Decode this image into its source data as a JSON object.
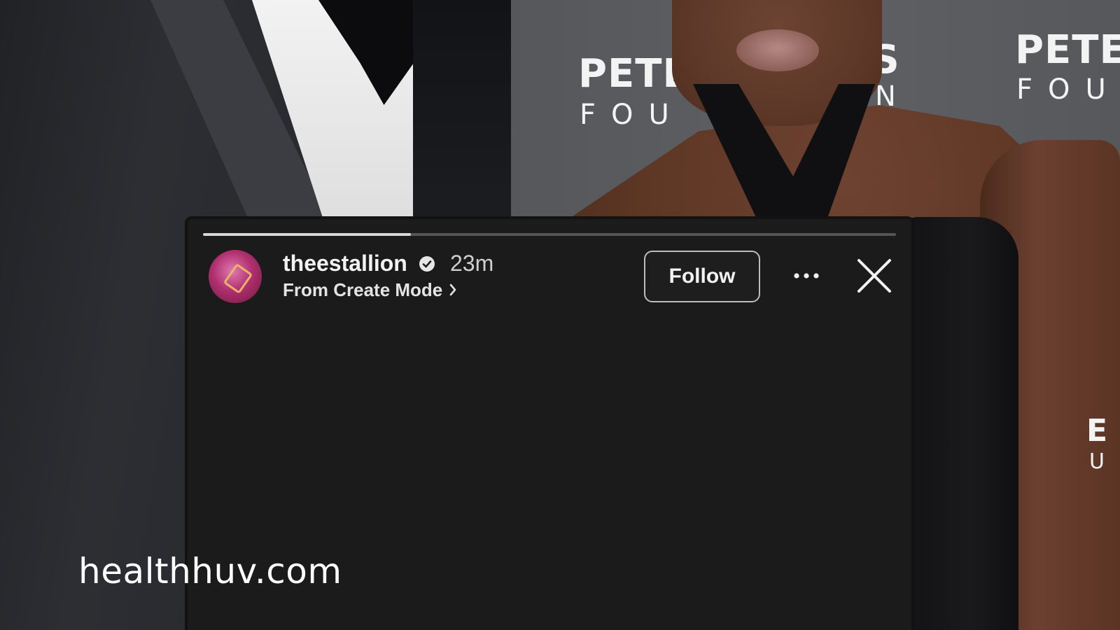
{
  "background": {
    "sponsor_left_line1": "PETE",
    "sponsor_left_line2": "FOU",
    "sponsor_mid_line1": "AS",
    "sponsor_mid_line2": "N",
    "sponsor_right_line1": "PETE",
    "sponsor_right_line2": "FOU",
    "sponsor_edge_line1": "E",
    "sponsor_edge_line2": "U"
  },
  "story": {
    "progress_fraction": 0.3,
    "avatar_icon": "avatar-image",
    "username": "theestallion",
    "verified_icon": "verified-badge-icon",
    "timestamp": "23m",
    "subtitle": "From Create Mode",
    "subtitle_icon": "chevron-right-icon",
    "follow_label": "Follow",
    "more_icon": "more-options-icon",
    "close_icon": "close-icon"
  },
  "watermark": "healthhuv.com",
  "colors": {
    "story_background": "#1b1b1b",
    "progress_fill": "#d8d8d8",
    "progress_track": "#555555",
    "text_primary": "#f2f2f2"
  }
}
